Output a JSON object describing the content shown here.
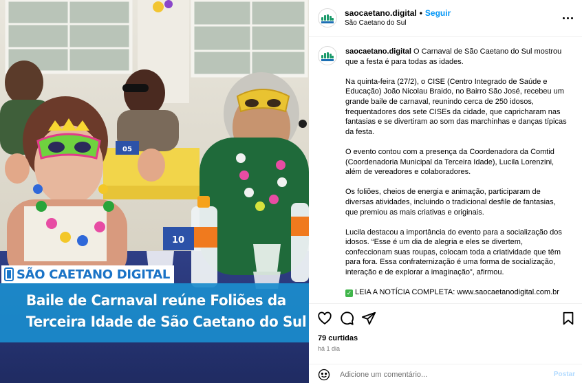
{
  "post_image": {
    "brand_label": "SÃO CAETANO DIGITAL",
    "headline_line1": "Baile de Carnaval reúne Foliões da",
    "headline_line2": "Terceira Idade de São Caetano do Sul",
    "table_numbers": [
      "05",
      "10"
    ]
  },
  "header": {
    "username": "saocaetano.digital",
    "separator": "•",
    "follow_label": "Seguir",
    "location": "São Caetano do Sul",
    "more_icon": "more-horizontal-icon"
  },
  "caption": {
    "username": "saocaetano.digital",
    "intro": "O Carnaval de São Caetano do Sul mostrou que a festa é para todas as idades.",
    "paragraphs": [
      "Na quinta-feira (27/2), o CISE (Centro Integrado de Saúde e Educação) João Nicolau Braido, no Bairro São José, recebeu um grande baile de carnaval, reunindo cerca de 250 idosos, frequentadores dos sete CISEs da cidade, que capricharam nas fantasias e se divertiram ao som das marchinhas e danças típicas da festa.",
      "O evento contou com a presença da Coordenadora da Comtid (Coordenadoria Municipal da Terceira Idade), Lucila Lorenzini, além de vereadores e colaboradores.",
      "Os foliões, cheios de energia e animação, participaram de diversas atividades, incluindo o tradicional desfile de fantasias, que premiou as mais criativas e originais.",
      "Lucila destacou a importância do evento para a socialização dos idosos. “Esse é um dia de alegria e eles se divertem, confeccionam suas roupas, colocam toda a criatividade que têm para fora. Essa confraternização é uma forma de socialização, interação e de explorar a imaginação”, afirmou."
    ],
    "cta": "LEIA A NOTÍCIA COMPLETA: www.saocaetanodigital.com.br",
    "cta_icon": "check-mark-icon"
  },
  "actions": {
    "icons": [
      "heart-icon",
      "comment-icon",
      "share-icon",
      "bookmark-icon"
    ],
    "likes": "79 curtidas",
    "time": "há 1 dia"
  },
  "comment": {
    "placeholder": "Adicione um comentário...",
    "post_label": "Postar",
    "emoji_icon": "emoji-icon"
  },
  "colors": {
    "follow_blue": "#0095f6",
    "headline_blue": "#1b8ccc",
    "brand_blue": "#1a73c6",
    "check_green": "#3fb54a"
  }
}
